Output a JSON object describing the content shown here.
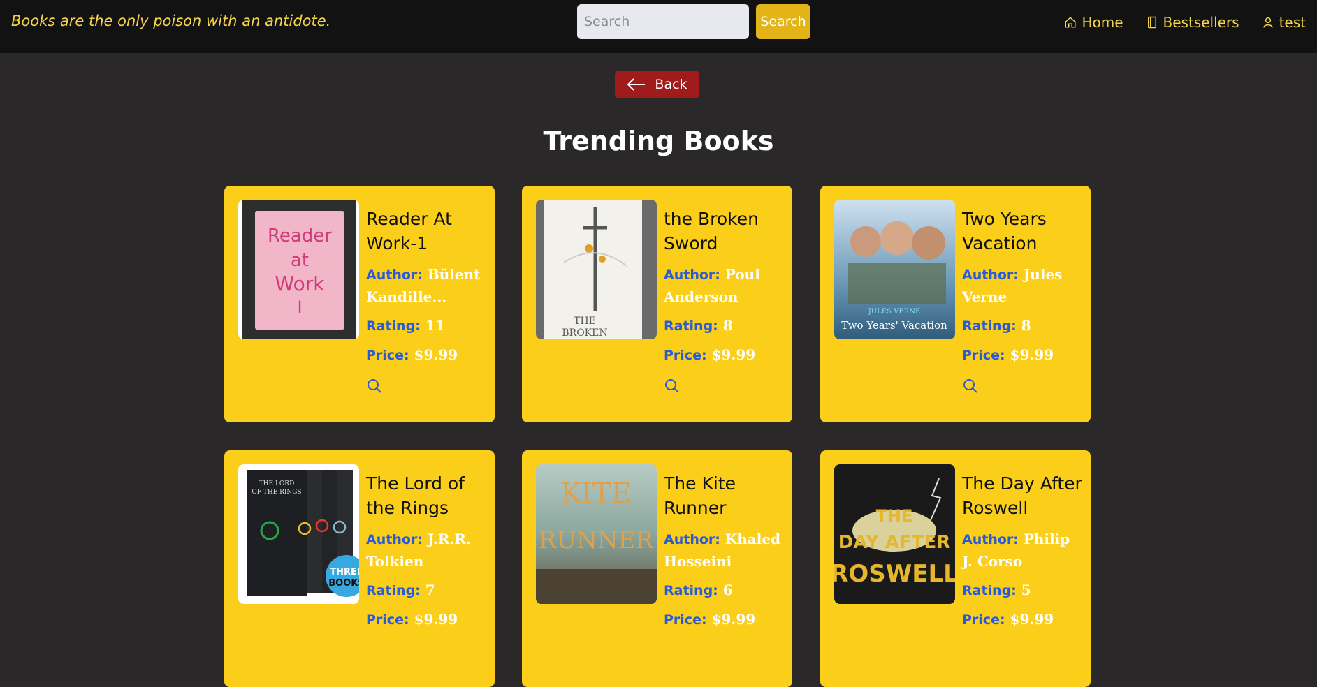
{
  "header": {
    "tagline": "Books are the only poison with an antidote.",
    "search_placeholder": "Search",
    "search_button": "Search",
    "nav": [
      {
        "label": "Home",
        "icon": "home-icon"
      },
      {
        "label": "Bestsellers",
        "icon": "book-icon"
      },
      {
        "label": "test",
        "icon": "user-icon"
      }
    ]
  },
  "back_label": "Back",
  "page_title": "Trending Books",
  "labels": {
    "author": "Author:",
    "rating": "Rating:",
    "price": "Price:"
  },
  "books": [
    {
      "title": "Reader At Work-1",
      "author": "Bülent Kandille...",
      "rating": "11",
      "price": "$9.99",
      "cover_text": "Reader at Work I"
    },
    {
      "title": "the Broken Sword",
      "author": "Poul Anderson",
      "rating": "8",
      "price": "$9.99",
      "cover_text": "THE BROKEN SWORD"
    },
    {
      "title": "Two Years Vacation",
      "author": "Jules Verne",
      "rating": "8",
      "price": "$9.99",
      "cover_text": "Two Years' Vacation"
    },
    {
      "title": "The Lord of the Rings",
      "author": "J.R.R. Tolkien",
      "rating": "7",
      "price": "$9.99",
      "cover_text": "THE LORD OF THE RINGS"
    },
    {
      "title": "The Kite Runner",
      "author": "Khaled Hosseini",
      "rating": "6",
      "price": "$9.99",
      "cover_text": "KITE RUNNER"
    },
    {
      "title": "The Day After Roswell",
      "author": "Philip J. Corso",
      "rating": "5",
      "price": "$9.99",
      "cover_text": "THE DAY AFTER ROSWELL"
    }
  ],
  "colors": {
    "accent": "#fbcf19",
    "nav_text": "#f5d547",
    "back": "#a01b1b",
    "label_blue": "#2a5bd7",
    "background": "#2a2829"
  }
}
